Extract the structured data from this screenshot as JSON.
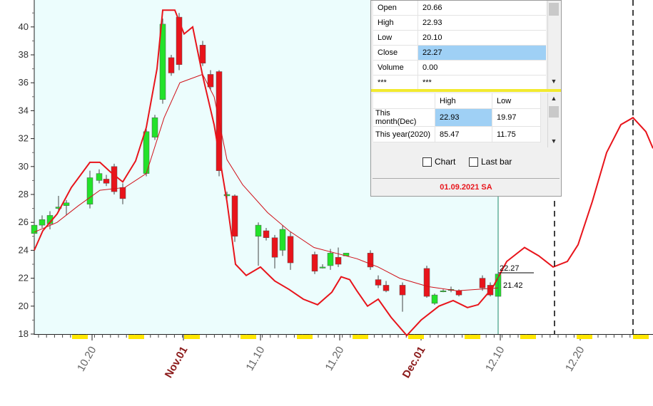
{
  "chart": {
    "y_ticks": [
      "40",
      "38",
      "36",
      "34",
      "32",
      "30",
      "28",
      "26",
      "24",
      "22",
      "20",
      "18"
    ],
    "x_ticks": [
      {
        "label": "10.20",
        "color": "#666666"
      },
      {
        "label": "Nov.01",
        "color": "#8b1a1a"
      },
      {
        "label": "11.10",
        "color": "#666666"
      },
      {
        "label": "11.20",
        "color": "#666666"
      },
      {
        "label": "Dec.01",
        "color": "#8b1a1a"
      },
      {
        "label": "12.10",
        "color": "#666666"
      },
      {
        "label": "12.20",
        "color": "#666666"
      }
    ],
    "last_price_label": "22.27",
    "avg_price_label": "21.42",
    "colors": {
      "up": "#22e22a",
      "down": "#e8141b",
      "line": "#e8141b",
      "bg": "#ecfdfd",
      "marker": "#ffe600"
    }
  },
  "quote_panel": {
    "rows": [
      {
        "label": "Open",
        "value": "20.66"
      },
      {
        "label": "High",
        "value": "22.93"
      },
      {
        "label": "Low",
        "value": "20.10"
      },
      {
        "label": "Close",
        "value": "22.27"
      },
      {
        "label": "Volume",
        "value": "0.00"
      },
      {
        "label": "***",
        "value": "***"
      }
    ]
  },
  "extremes_panel": {
    "headers": [
      "High",
      "Low"
    ],
    "rows": [
      {
        "label": "This month(Dec)",
        "high": "22.93",
        "low": "19.97"
      },
      {
        "label": "This year(2020)",
        "high": "85.47",
        "low": "11.75"
      }
    ]
  },
  "options": {
    "chart_label": "Chart",
    "lastbar_label": "Last bar"
  },
  "status": {
    "date_text": "01.09.2021 SA"
  }
}
